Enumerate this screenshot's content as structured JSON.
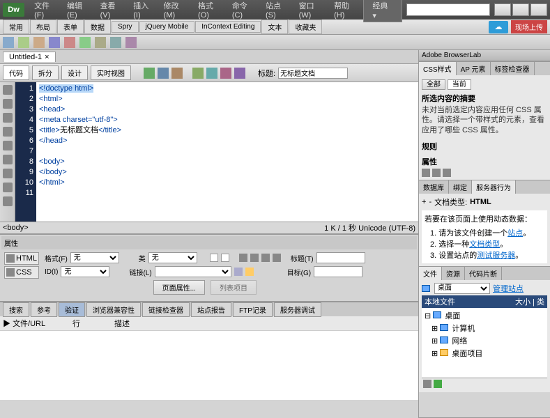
{
  "app": {
    "logo": "Dw",
    "workspace": "经典",
    "min": "—",
    "max": "□",
    "close": "X"
  },
  "menu": [
    "文件(F)",
    "编辑(E)",
    "查看(V)",
    "插入(I)",
    "修改(M)",
    "格式(O)",
    "命令(C)",
    "站点(S)",
    "窗口(W)",
    "帮助(H)"
  ],
  "toolbar2": [
    "常用",
    "布局",
    "表单",
    "数据",
    "Spry",
    "jQuery Mobile",
    "InContext Editing",
    "文本",
    "收藏夹"
  ],
  "live_label": "现场上传",
  "doc": {
    "tab": "Untitled-1",
    "close": "×"
  },
  "views": {
    "code": "代码",
    "split": "拆分",
    "design": "设计",
    "live": "实时视图"
  },
  "title_label": "标题:",
  "title_value": "无标题文档",
  "code_lines": [
    "1",
    "2",
    "3",
    "4",
    "5",
    "6",
    "7",
    "8",
    "9",
    "10",
    "11"
  ],
  "code": {
    "l1": "<!doctype html>",
    "l2": "<html>",
    "l3": "<head>",
    "l4": "<meta charset=\"utf-8\">",
    "l5a": "<title>",
    "l5b": "无标题文档",
    "l5c": "</title>",
    "l6": "</head>",
    "l8": "<body>",
    "l9": "</body>",
    "l10": "</html>"
  },
  "tagpath": {
    "left": "<body>",
    "right": "1 K / 1 秒 Unicode (UTF-8)"
  },
  "props": {
    "hdr": "属性",
    "html": "HTML",
    "css": "CSS",
    "format": "格式(F)",
    "id": "ID(I)",
    "class": "类",
    "link": "链接(L)",
    "none": "无",
    "title": "标题(T)",
    "target": "目标(G)",
    "btn1": "页面属性...",
    "btn2": "列表项目"
  },
  "bottom": {
    "tabs": [
      "搜索",
      "参考",
      "验证",
      "浏览器兼容性",
      "链接检查器",
      "站点报告",
      "FTP记录",
      "服务器调试"
    ],
    "col1": "文件/URL",
    "col2": "行",
    "col3": "描述"
  },
  "right": {
    "browserlab": "Adobe BrowserLab",
    "css_tabs": [
      "CSS样式",
      "AP 元素",
      "标签检查器"
    ],
    "all": "全部",
    "current": "当前",
    "summary_hdr": "所选内容的摘要",
    "summary_txt": "未对当前选定内容应用任何 CSS 属性。请选择一个带样式的元素，查看应用了哪些 CSS 属性。",
    "rules": "规则",
    "attrs": "属性",
    "db_tabs": [
      "数据库",
      "绑定",
      "服务器行为"
    ],
    "doctype_lbl": "文档类型:",
    "doctype_val": "HTML",
    "db_intro": "若要在该页面上使用动态数据：",
    "db_1": "1. 请为该文件创建一个",
    "db_1l": "站点",
    "db_1e": "。",
    "db_2": "2. 选择一种",
    "db_2l": "文档类型",
    "db_2e": "。",
    "db_3": "3. 设置站点的",
    "db_3l": "测试服务器",
    "db_3e": "。",
    "files_tabs": [
      "文件",
      "资源",
      "代码片断"
    ],
    "desktop": "桌面",
    "manage": "管理站点",
    "local_hdr": "本地文件",
    "size_hdr": "大小 | 类",
    "tree": {
      "root": "桌面",
      "n1": "计算机",
      "n2": "网络",
      "n3": "桌面项目"
    }
  }
}
